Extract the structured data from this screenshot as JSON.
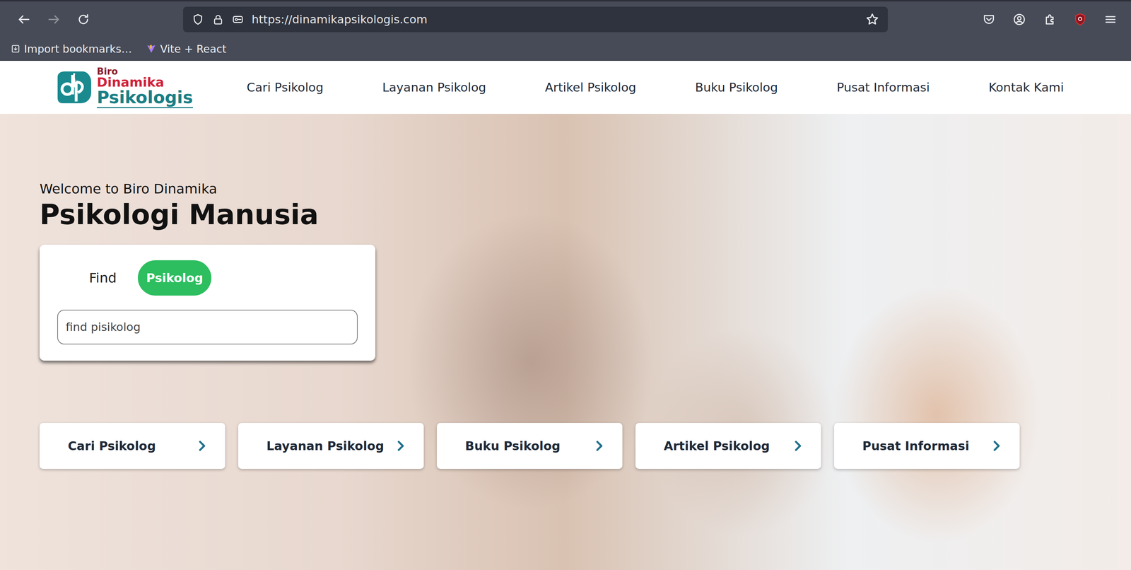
{
  "browser": {
    "url": "https://dinamikapsikologis.com",
    "forward_disabled": true,
    "bookmarks": [
      "Import bookmarks…",
      "Vite + React"
    ]
  },
  "site": {
    "logo": {
      "line1": "Biro",
      "line2": "Dinamika",
      "line3": "Psikologis"
    },
    "nav": [
      "Cari Psikolog",
      "Layanan Psikolog",
      "Artikel Psikolog",
      "Buku Psikolog",
      "Pusat Informasi",
      "Kontak Kami"
    ]
  },
  "hero": {
    "welcome": "Welcome to Biro Dinamika",
    "title": "Psikologi Manusia",
    "search": {
      "label": "Find",
      "tab": "Psikolog",
      "placeholder": "find pisikolog"
    },
    "links": [
      "Cari Psikolog",
      "Layanan Psikolog",
      "Buku Psikolog",
      "Artikel Psikolog",
      "Pusat Informasi"
    ]
  }
}
